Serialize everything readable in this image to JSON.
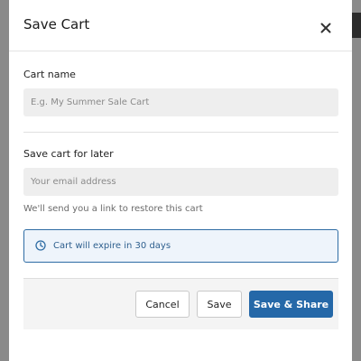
{
  "modal": {
    "title": "Save Cart",
    "close_icon": "close-icon"
  },
  "cart_name": {
    "label": "Cart name",
    "placeholder": "E.g. My Summer Sale Cart",
    "value": ""
  },
  "save_for_later": {
    "label": "Save cart for later",
    "email_placeholder": "Your email address",
    "email_value": "",
    "helper": "We'll send you a link to restore this cart"
  },
  "info": {
    "icon": "clock-icon",
    "text": "Cart will expire in 30 days",
    "accent_color": "#2e6ca4"
  },
  "footer": {
    "cancel_label": "Cancel",
    "save_label": "Save",
    "save_share_label": "Save & Share",
    "primary_color": "#2568a8"
  }
}
